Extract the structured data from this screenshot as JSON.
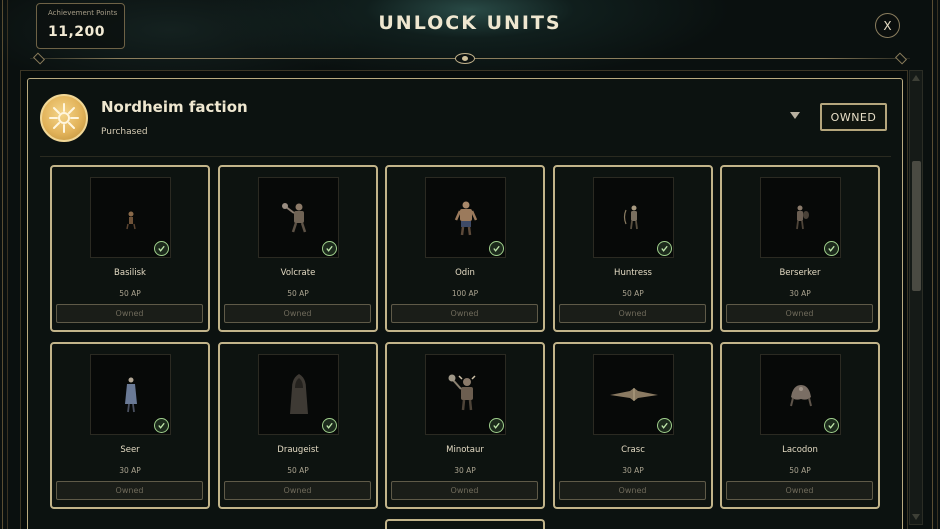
{
  "header": {
    "achievement_label": "Achievement Points",
    "achievement_value": "11,200",
    "title": "UNLOCK UNITS",
    "close_label": "X"
  },
  "faction": {
    "name": "Nordheim faction",
    "status": "Purchased",
    "owned_button": "OWNED",
    "emblem_icon": "sun-emblem-icon"
  },
  "units": [
    {
      "name": "Basilisk",
      "cost": "50 AP",
      "button": "Owned",
      "icon": "basilisk-figure"
    },
    {
      "name": "Volcrate",
      "cost": "50 AP",
      "button": "Owned",
      "icon": "volcrate-figure"
    },
    {
      "name": "Odin",
      "cost": "100 AP",
      "button": "Owned",
      "icon": "odin-figure"
    },
    {
      "name": "Huntress",
      "cost": "50 AP",
      "button": "Owned",
      "icon": "huntress-figure"
    },
    {
      "name": "Berserker",
      "cost": "30 AP",
      "button": "Owned",
      "icon": "berserker-figure"
    },
    {
      "name": "Seer",
      "cost": "30 AP",
      "button": "Owned",
      "icon": "seer-figure"
    },
    {
      "name": "Draugeist",
      "cost": "50 AP",
      "button": "Owned",
      "icon": "draugeist-figure"
    },
    {
      "name": "Minotaur",
      "cost": "30 AP",
      "button": "Owned",
      "icon": "minotaur-figure"
    },
    {
      "name": "Crasc",
      "cost": "30 AP",
      "button": "Owned",
      "icon": "crasc-figure"
    },
    {
      "name": "Lacodon",
      "cost": "50 AP",
      "button": "Owned",
      "icon": "lacodon-figure"
    }
  ],
  "colors": {
    "accent_gold": "#c2b48a",
    "check_green": "#9fcf8c",
    "background": "#0b1110"
  }
}
